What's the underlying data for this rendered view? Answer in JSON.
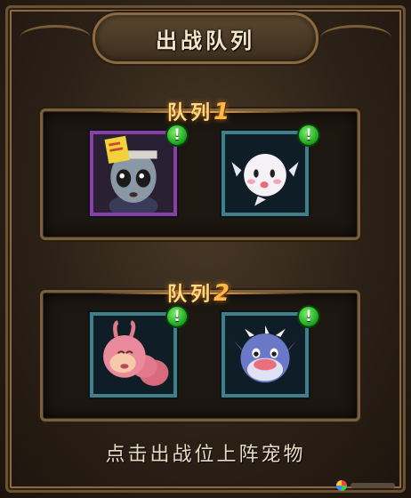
{
  "title": "出战队列",
  "teams": [
    {
      "label": "队列",
      "number": "1",
      "pets": [
        {
          "name": "zombie-doll-pet",
          "frame_color": "#8a3fa8",
          "alert": "!"
        },
        {
          "name": "white-pufferfish-pet",
          "frame_color": "#3f7f8a",
          "alert": "!"
        }
      ]
    },
    {
      "label": "队列",
      "number": "2",
      "pets": [
        {
          "name": "pink-worm-pet",
          "frame_color": "#3f7f8a",
          "alert": "!"
        },
        {
          "name": "blue-pufferfish-pet",
          "frame_color": "#3f7f8a",
          "alert": "!"
        }
      ]
    }
  ],
  "hint": "点击出战位上阵宠物",
  "colors": {
    "accent_gold": "#ffd98a",
    "alert_green": "#18a21c",
    "frame_bronze": "#7a5f3c"
  }
}
